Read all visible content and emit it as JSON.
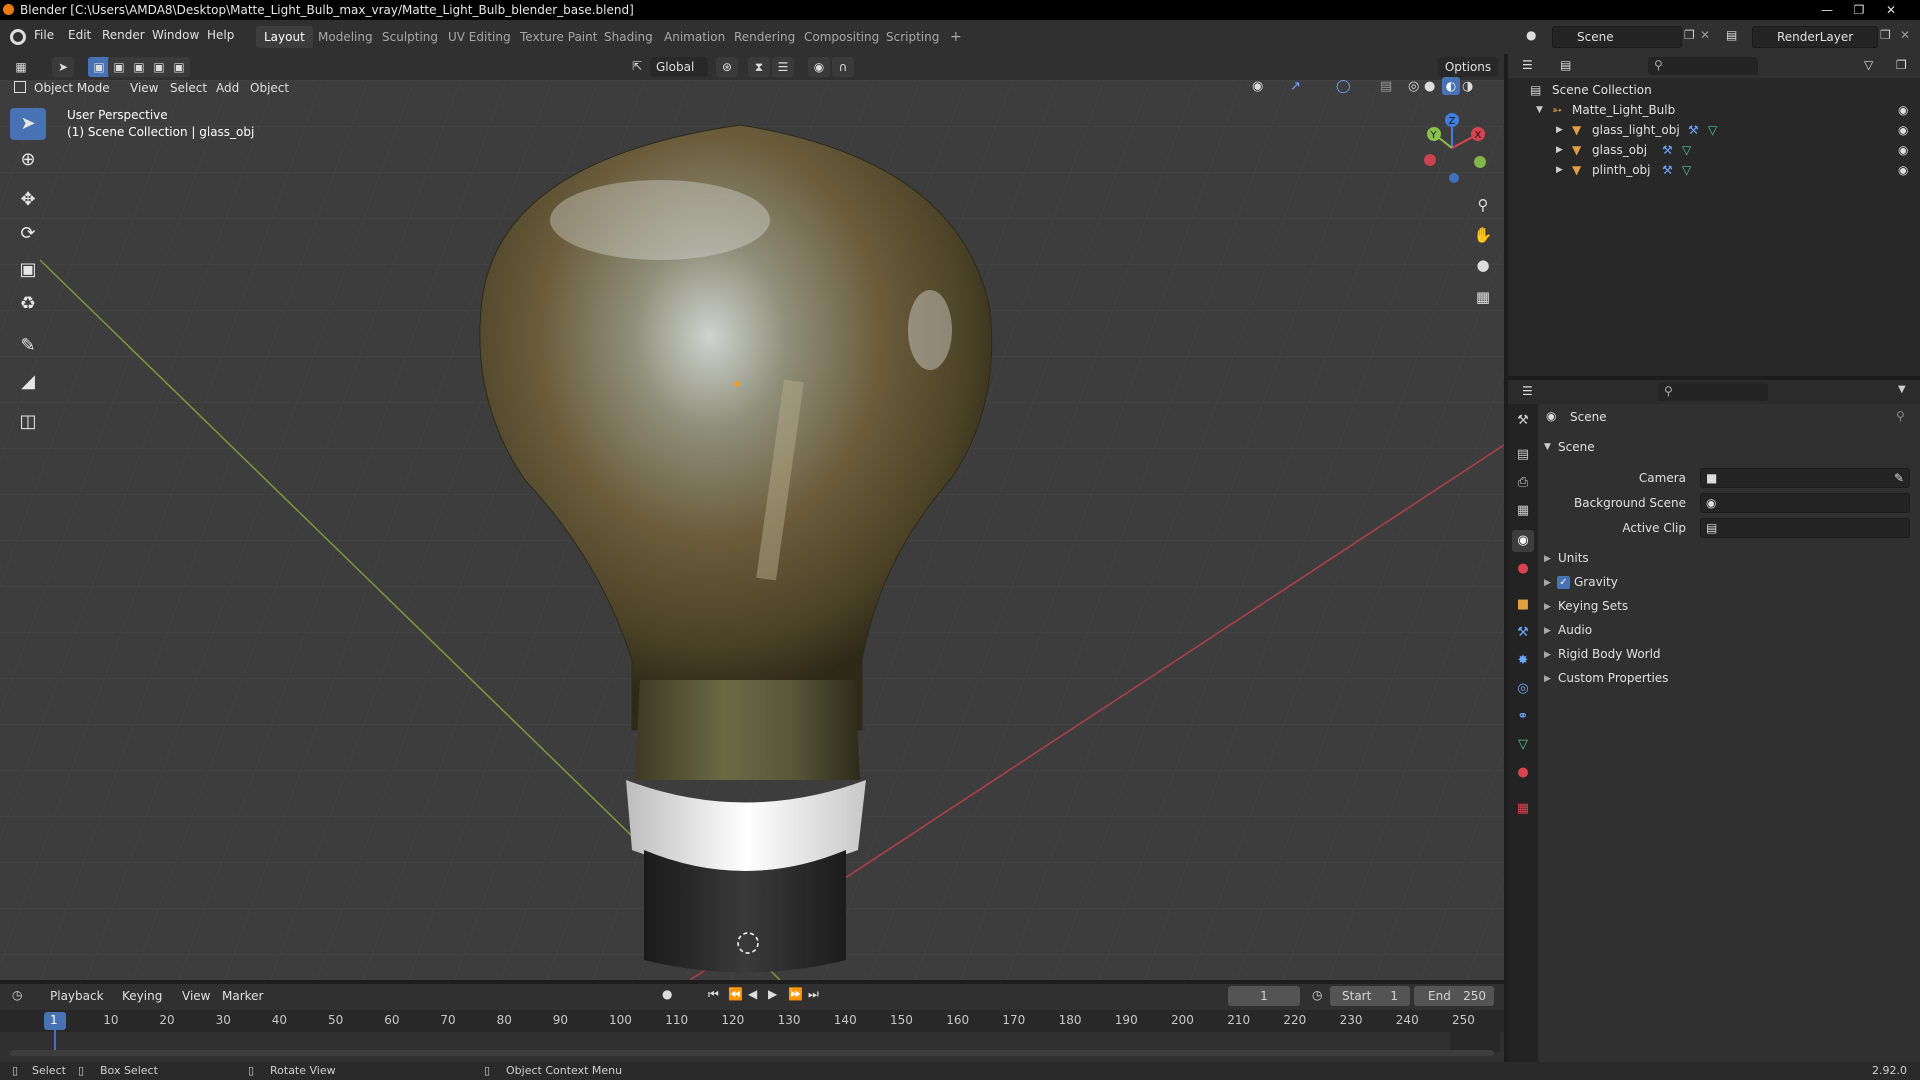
{
  "window": {
    "title": "Blender [C:\\Users\\AMDA8\\Desktop\\Matte_Light_Bulb_max_vray/Matte_Light_Bulb_blender_base.blend]"
  },
  "menu": [
    "File",
    "Edit",
    "Render",
    "Window",
    "Help"
  ],
  "workspaces": [
    "Layout",
    "Modeling",
    "Sculpting",
    "UV Editing",
    "Texture Paint",
    "Shading",
    "Animation",
    "Rendering",
    "Compositing",
    "Scripting"
  ],
  "scene_name": "Scene",
  "render_layer": "RenderLayer",
  "header": {
    "transform": "Global",
    "options": "Options"
  },
  "viewport_header": {
    "mode": "Object Mode",
    "menus": [
      "View",
      "Select",
      "Add",
      "Object"
    ]
  },
  "viewport": {
    "perspective": "User Perspective",
    "collection": "(1) Scene Collection | glass_obj"
  },
  "gizmo": {
    "x": "X",
    "y": "Y",
    "z": "Z"
  },
  "outliner": {
    "root": "Scene Collection",
    "collection": "Matte_Light_Bulb",
    "objects": [
      "glass_light_obj",
      "glass_obj",
      "plinth_obj"
    ]
  },
  "properties": {
    "breadcrumb": "Scene",
    "panel_title": "Scene",
    "fields": [
      {
        "label": "Camera"
      },
      {
        "label": "Background Scene"
      },
      {
        "label": "Active Clip"
      }
    ],
    "sections": [
      "Units",
      "Gravity",
      "Keying Sets",
      "Audio",
      "Rigid Body World",
      "Custom Properties"
    ],
    "gravity_enabled": true
  },
  "timeline": {
    "menus": [
      "Playback",
      "Keying",
      "View",
      "Marker"
    ],
    "current_frame": "1",
    "start_label": "Start",
    "start": "1",
    "end_label": "End",
    "end": "250",
    "ticks": [
      "1",
      "10",
      "20",
      "30",
      "40",
      "50",
      "60",
      "70",
      "80",
      "90",
      "100",
      "110",
      "120",
      "130",
      "140",
      "150",
      "160",
      "170",
      "180",
      "190",
      "200",
      "210",
      "220",
      "230",
      "240",
      "250"
    ]
  },
  "status": {
    "select": "Select",
    "box_select": "Box Select",
    "rotate": "Rotate View",
    "context": "Object Context Menu",
    "version": "2.92.0"
  },
  "colors": {
    "accent": "#4772b3",
    "viewport_bg": "#3d3d3d",
    "x_axis": "#d9434f",
    "y_axis": "#8bc34a",
    "z_axis": "#3d7fe0"
  }
}
